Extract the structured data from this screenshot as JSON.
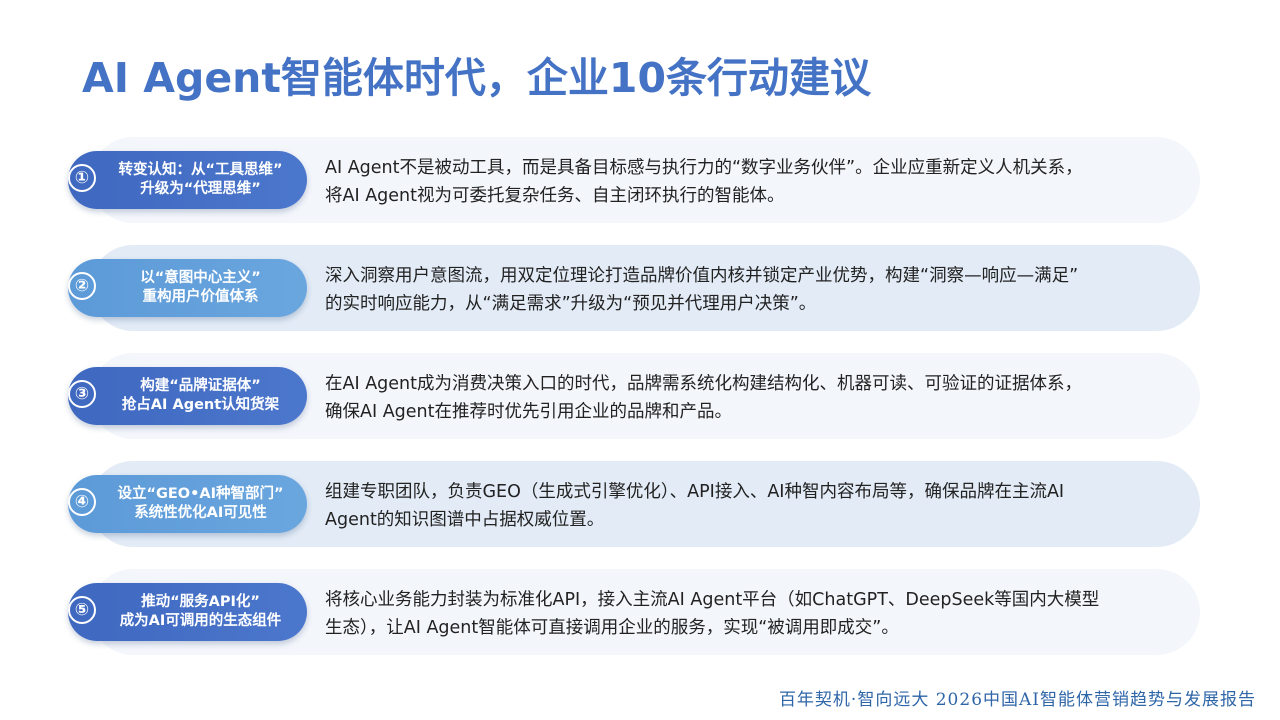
{
  "title": "AI Agent智能体时代，企业10条行动建议",
  "items": [
    {
      "number": "①",
      "heading_line1": "转变认知：从“工具思维”",
      "heading_line2": "升级为“代理思维”",
      "desc_line1": "AI Agent不是被动工具，而是具备目标感与执行力的“数字业务伙伴”。企业应重新定义人机关系，",
      "desc_line2": "将AI Agent视为可委托复杂任务、自主闭环执行的智能体。"
    },
    {
      "number": "②",
      "heading_line1": "以“意图中心主义”",
      "heading_line2": "重构用户价值体系",
      "desc_line1": "深入洞察用户意图流，用双定位理论打造品牌价值内核并锁定产业优势，构建“洞察—响应—满足”",
      "desc_line2": "的实时响应能力，从“满足需求”升级为“预见并代理用户决策”。"
    },
    {
      "number": "③",
      "heading_line1": "构建“品牌证据体”",
      "heading_line2": "抢占AI Agent认知货架",
      "desc_line1": "在AI Agent成为消费决策入口的时代，品牌需系统化构建结构化、机器可读、可验证的证据体系，",
      "desc_line2": "确保AI Agent在推荐时优先引用企业的品牌和产品。"
    },
    {
      "number": "④",
      "heading_line1": "设立“GEO•AI种智部门”",
      "heading_line2": "系统性优化AI可见性",
      "desc_line1": "组建专职团队，负责GEO（生成式引擎优化）、API接入、AI种智内容布局等，确保品牌在主流AI",
      "desc_line2": "Agent的知识图谱中占据权威位置。"
    },
    {
      "number": "⑤",
      "heading_line1": "推动“服务API化”",
      "heading_line2": "成为AI可调用的生态组件",
      "desc_line1": "将核心业务能力封装为标准化API，接入主流AI Agent平台（如ChatGPT、DeepSeek等国内大模型",
      "desc_line2": "生态），让AI Agent智能体可直接调用企业的服务，实现“被调用即成交”。"
    }
  ],
  "footer": "百年契机·智向远大 2026中国AI智能体营销趋势与发展报告",
  "colors": {
    "title": "#4472c4",
    "pill_dark": "#4472c4",
    "pill_light": "#5c9ad8",
    "card_light": "#f3f6fb",
    "card_tint": "#e2ebf6",
    "footer": "#2f66a8"
  }
}
